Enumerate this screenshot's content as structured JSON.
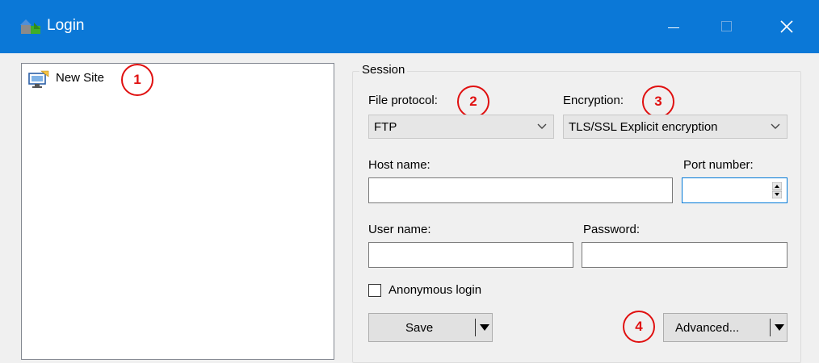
{
  "window": {
    "title": "Login",
    "app_icon": "winscp-login-icon"
  },
  "site_tree": {
    "items": [
      {
        "label": "New Site",
        "icon": "monitor-site-icon"
      }
    ]
  },
  "session": {
    "group_label": "Session",
    "file_protocol": {
      "label": "File protocol:",
      "value": "FTP"
    },
    "encryption": {
      "label": "Encryption:",
      "value": "TLS/SSL Explicit encryption"
    },
    "host_name": {
      "label": "Host name:",
      "value": ""
    },
    "port_number": {
      "label": "Port number:",
      "value": ""
    },
    "user_name": {
      "label": "User name:",
      "value": ""
    },
    "password": {
      "label": "Password:",
      "value": ""
    },
    "anonymous_login": {
      "label": "Anonymous login",
      "checked": false
    },
    "save_button": "Save",
    "advanced_button": "Advanced..."
  },
  "callouts": [
    "1",
    "2",
    "3",
    "4"
  ],
  "colors": {
    "title_bar": "#0b78d7",
    "callout": "#e01010",
    "focus_border": "#0078d7"
  }
}
